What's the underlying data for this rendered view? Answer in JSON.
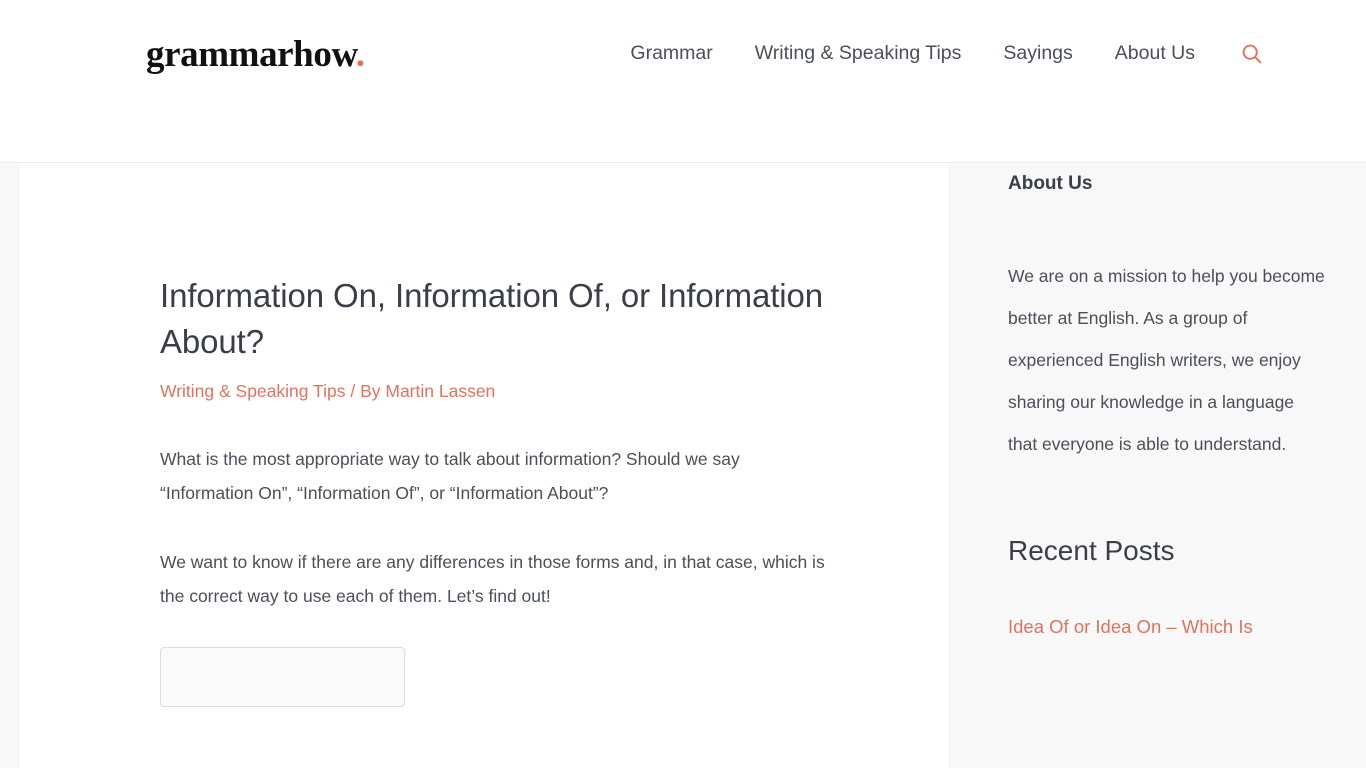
{
  "header": {
    "logo_text": "grammarhow",
    "logo_dot": ".",
    "nav": [
      {
        "label": "Grammar",
        "name": "nav-grammar"
      },
      {
        "label": "Writing & Speaking Tips",
        "name": "nav-writing-speaking-tips"
      },
      {
        "label": "Sayings",
        "name": "nav-sayings"
      },
      {
        "label": "About Us",
        "name": "nav-about-us"
      }
    ],
    "search_icon": "search-icon"
  },
  "article": {
    "title": "Information On, Information Of, or Information About?",
    "category": "Writing & Speaking Tips",
    "byline_separator": "/ By",
    "author": "Martin Lassen",
    "paragraphs": [
      "What is the most appropriate way to talk about information? Should we say “Information On”, “Information Of”, or “Information About”?",
      "We want to know if there are any differences in those forms and, in that case, which is the correct way to use each of them. Let’s find out!"
    ]
  },
  "sidebar": {
    "about": {
      "title": "About Us",
      "text": "We are on a mission to help you become better at English. As a group of experienced English writers, we enjoy sharing our knowledge in a language that everyone is able to understand."
    },
    "recent": {
      "title": "Recent Posts",
      "posts": [
        {
          "label": "Idea Of or Idea On – Which Is"
        }
      ]
    }
  },
  "colors": {
    "accent": "#e0735c",
    "text": "#4a4f58",
    "heading": "#3a3f47",
    "page_bg": "#f8f8f8",
    "card_bg": "#ffffff"
  }
}
